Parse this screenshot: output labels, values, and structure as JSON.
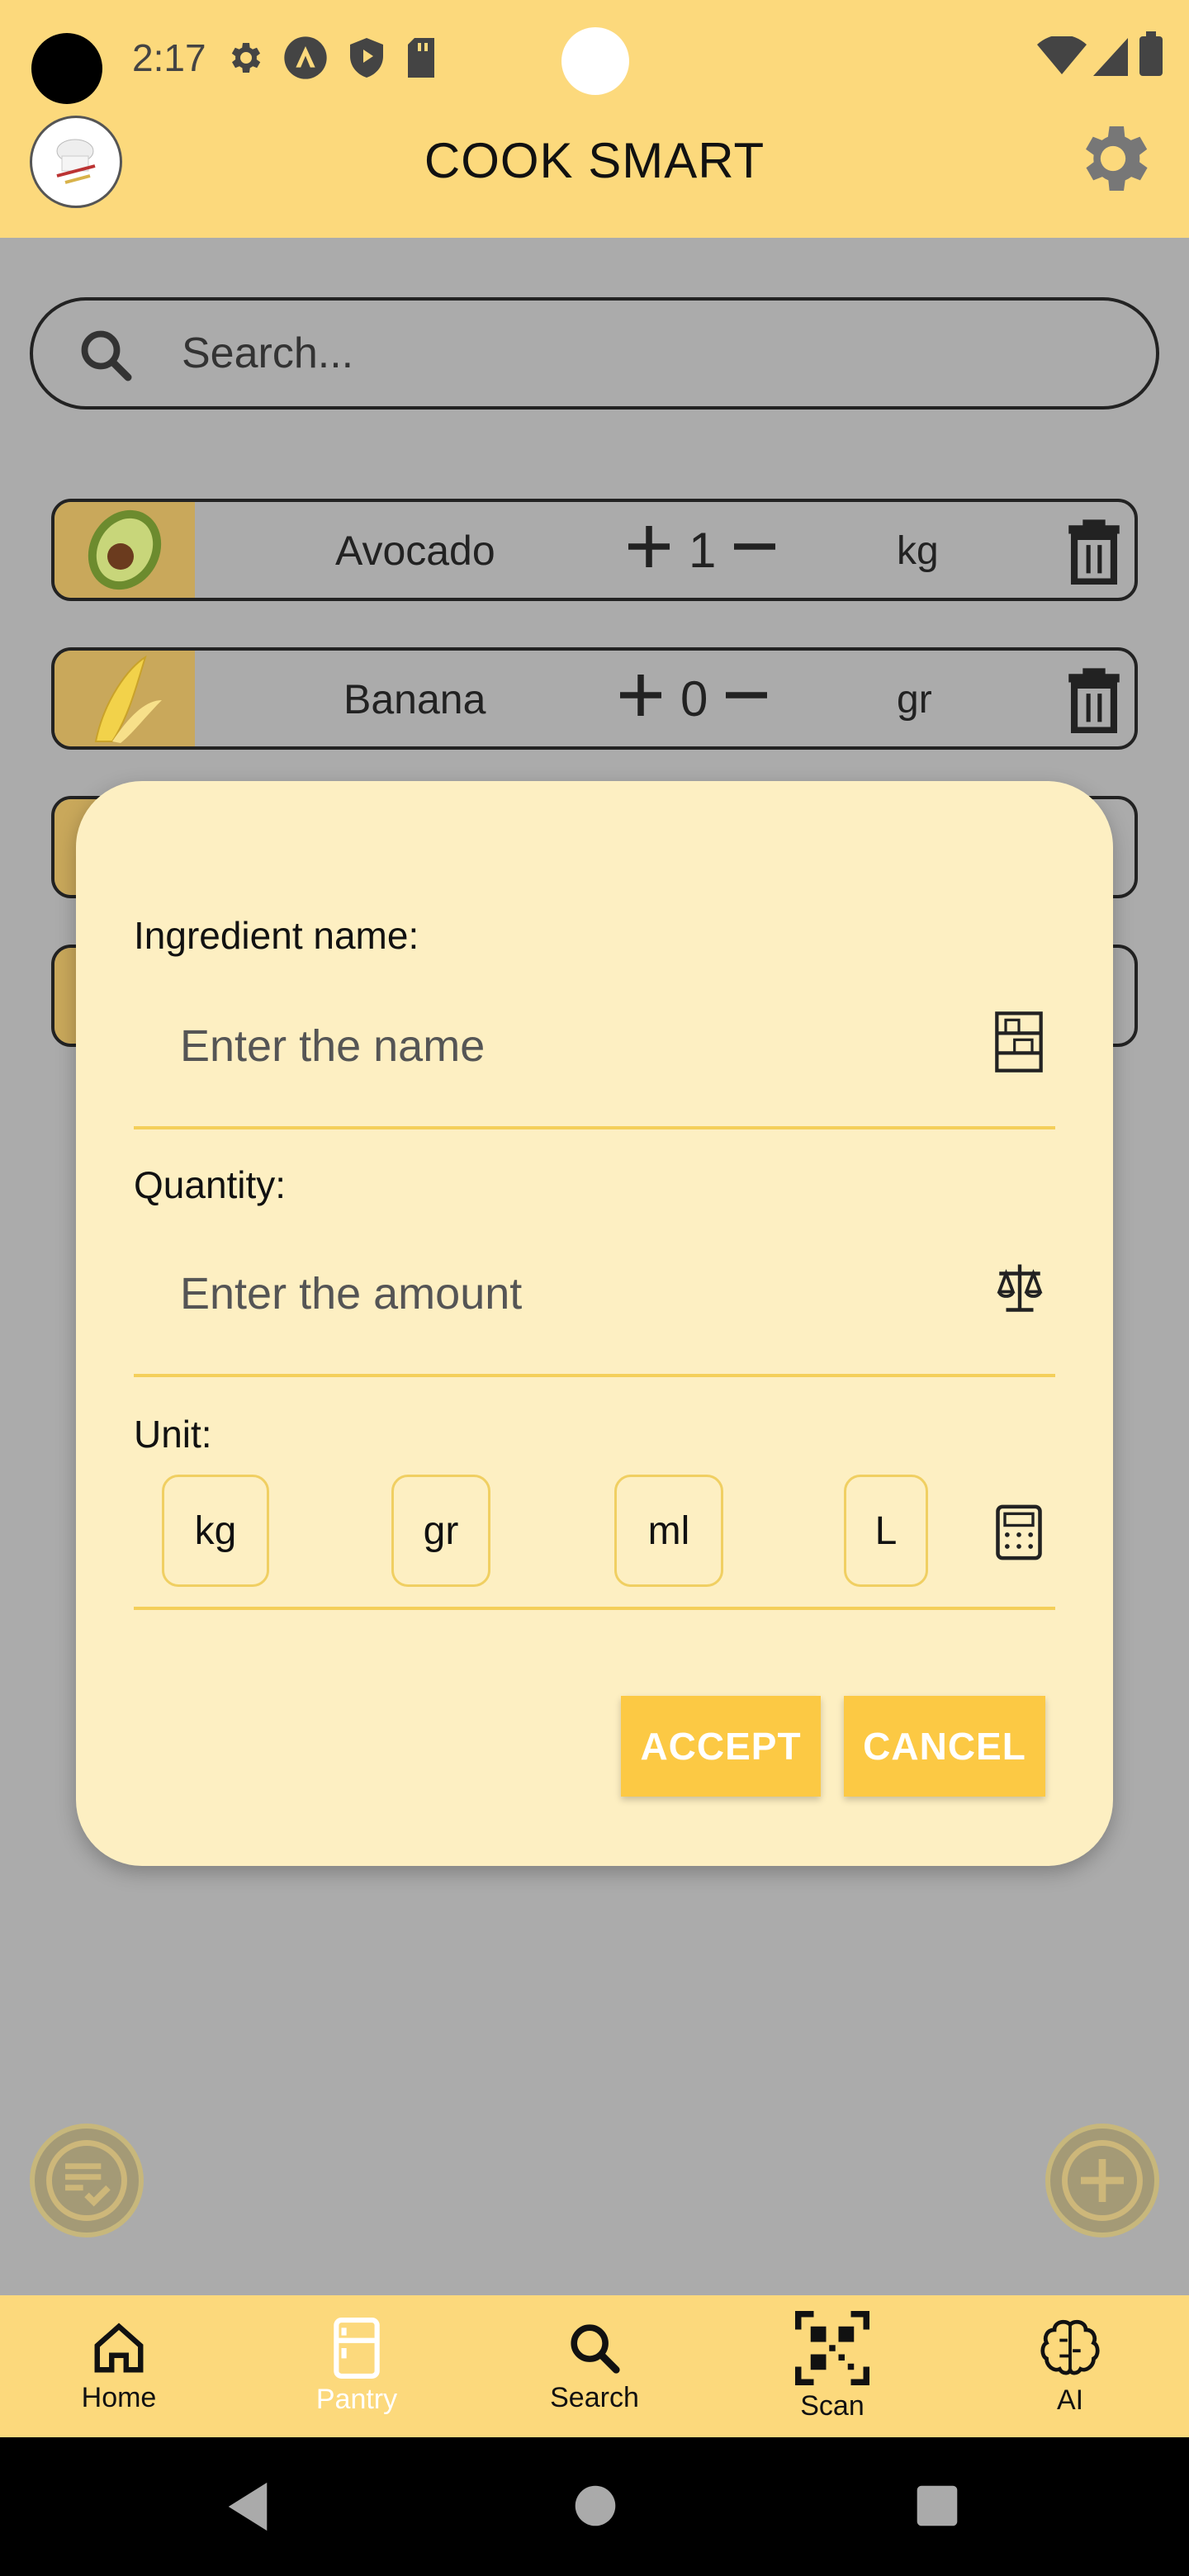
{
  "status": {
    "time": "2:17"
  },
  "header": {
    "title": "COOK SMART"
  },
  "search": {
    "placeholder": "Search..."
  },
  "pantry": {
    "items": [
      {
        "name": "Avocado",
        "quantity": "1",
        "unit": "kg"
      },
      {
        "name": "Banana",
        "quantity": "0",
        "unit": "gr"
      }
    ]
  },
  "dialog": {
    "ingredient_label": "Ingredient name:",
    "name_placeholder": "Enter the name",
    "quantity_label": "Quantity:",
    "quantity_placeholder": "Enter the amount",
    "unit_label": "Unit:",
    "units": [
      "kg",
      "gr",
      "ml",
      "L"
    ],
    "accept": "ACCEPT",
    "cancel": "CANCEL"
  },
  "bottom_nav": {
    "items": [
      {
        "label": "Home",
        "icon": "home-icon"
      },
      {
        "label": "Pantry",
        "icon": "fridge-icon"
      },
      {
        "label": "Search",
        "icon": "search-icon"
      },
      {
        "label": "Scan",
        "icon": "qr-code-icon"
      },
      {
        "label": "AI",
        "icon": "brain-icon"
      }
    ],
    "active": "Pantry"
  },
  "colors": {
    "header": "#fcd97c",
    "dialog_bg": "#fdefc2",
    "button": "#fcc944",
    "overlay": "#ababab"
  }
}
